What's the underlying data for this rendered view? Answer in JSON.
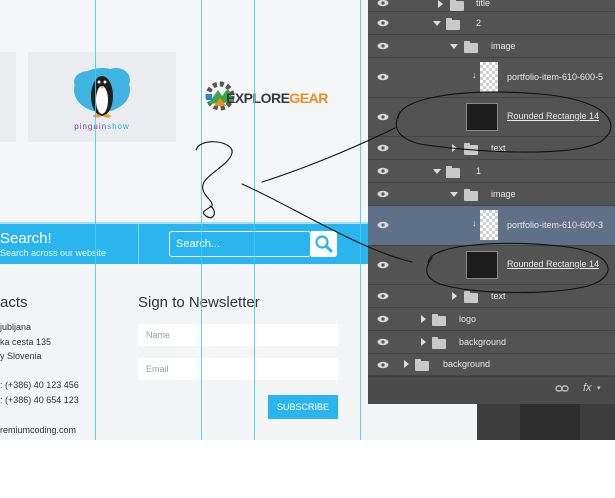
{
  "website": {
    "logos": {
      "pinguin_part1": "pinguin",
      "pinguin_part2": "show",
      "explore_part1": "EXPLORE",
      "explore_part2": "GEAR"
    },
    "search": {
      "title": "Search!",
      "subtitle": "Search across our website",
      "placeholder": "Search..."
    },
    "contacts": {
      "title": "acts",
      "lines": [
        "jubljana",
        "ka cesta 135",
        "y Slovenia",
        ": (+386) 40 123 456",
        ": (+386) 40 654 123",
        "remiumcoding.com"
      ]
    },
    "newsletter": {
      "title": "Sign to Newsletter",
      "name_placeholder": "Name",
      "email_placeholder": "Email",
      "subscribe_label": "SUBSCRIBE"
    }
  },
  "layers_panel": {
    "layers": [
      {
        "label": "title"
      },
      {
        "label": "2"
      },
      {
        "label": "image"
      },
      {
        "label": "portfolio-item-610-600-5"
      },
      {
        "label": "Rounded Rectangle 14"
      },
      {
        "label": "text"
      },
      {
        "label": "1"
      },
      {
        "label": "image"
      },
      {
        "label": "portfolio-item-610-600-3"
      },
      {
        "label": "Rounded Rectangle 14"
      },
      {
        "label": "text"
      },
      {
        "label": "logo"
      },
      {
        "label": "background"
      },
      {
        "label": "background"
      }
    ],
    "footer_fx": "fx"
  },
  "colors": {
    "accent_blue": "#2ab5ee",
    "panel_bg": "#535353",
    "selected_row": "#5f7189",
    "guide_line": "#33d6f0"
  }
}
